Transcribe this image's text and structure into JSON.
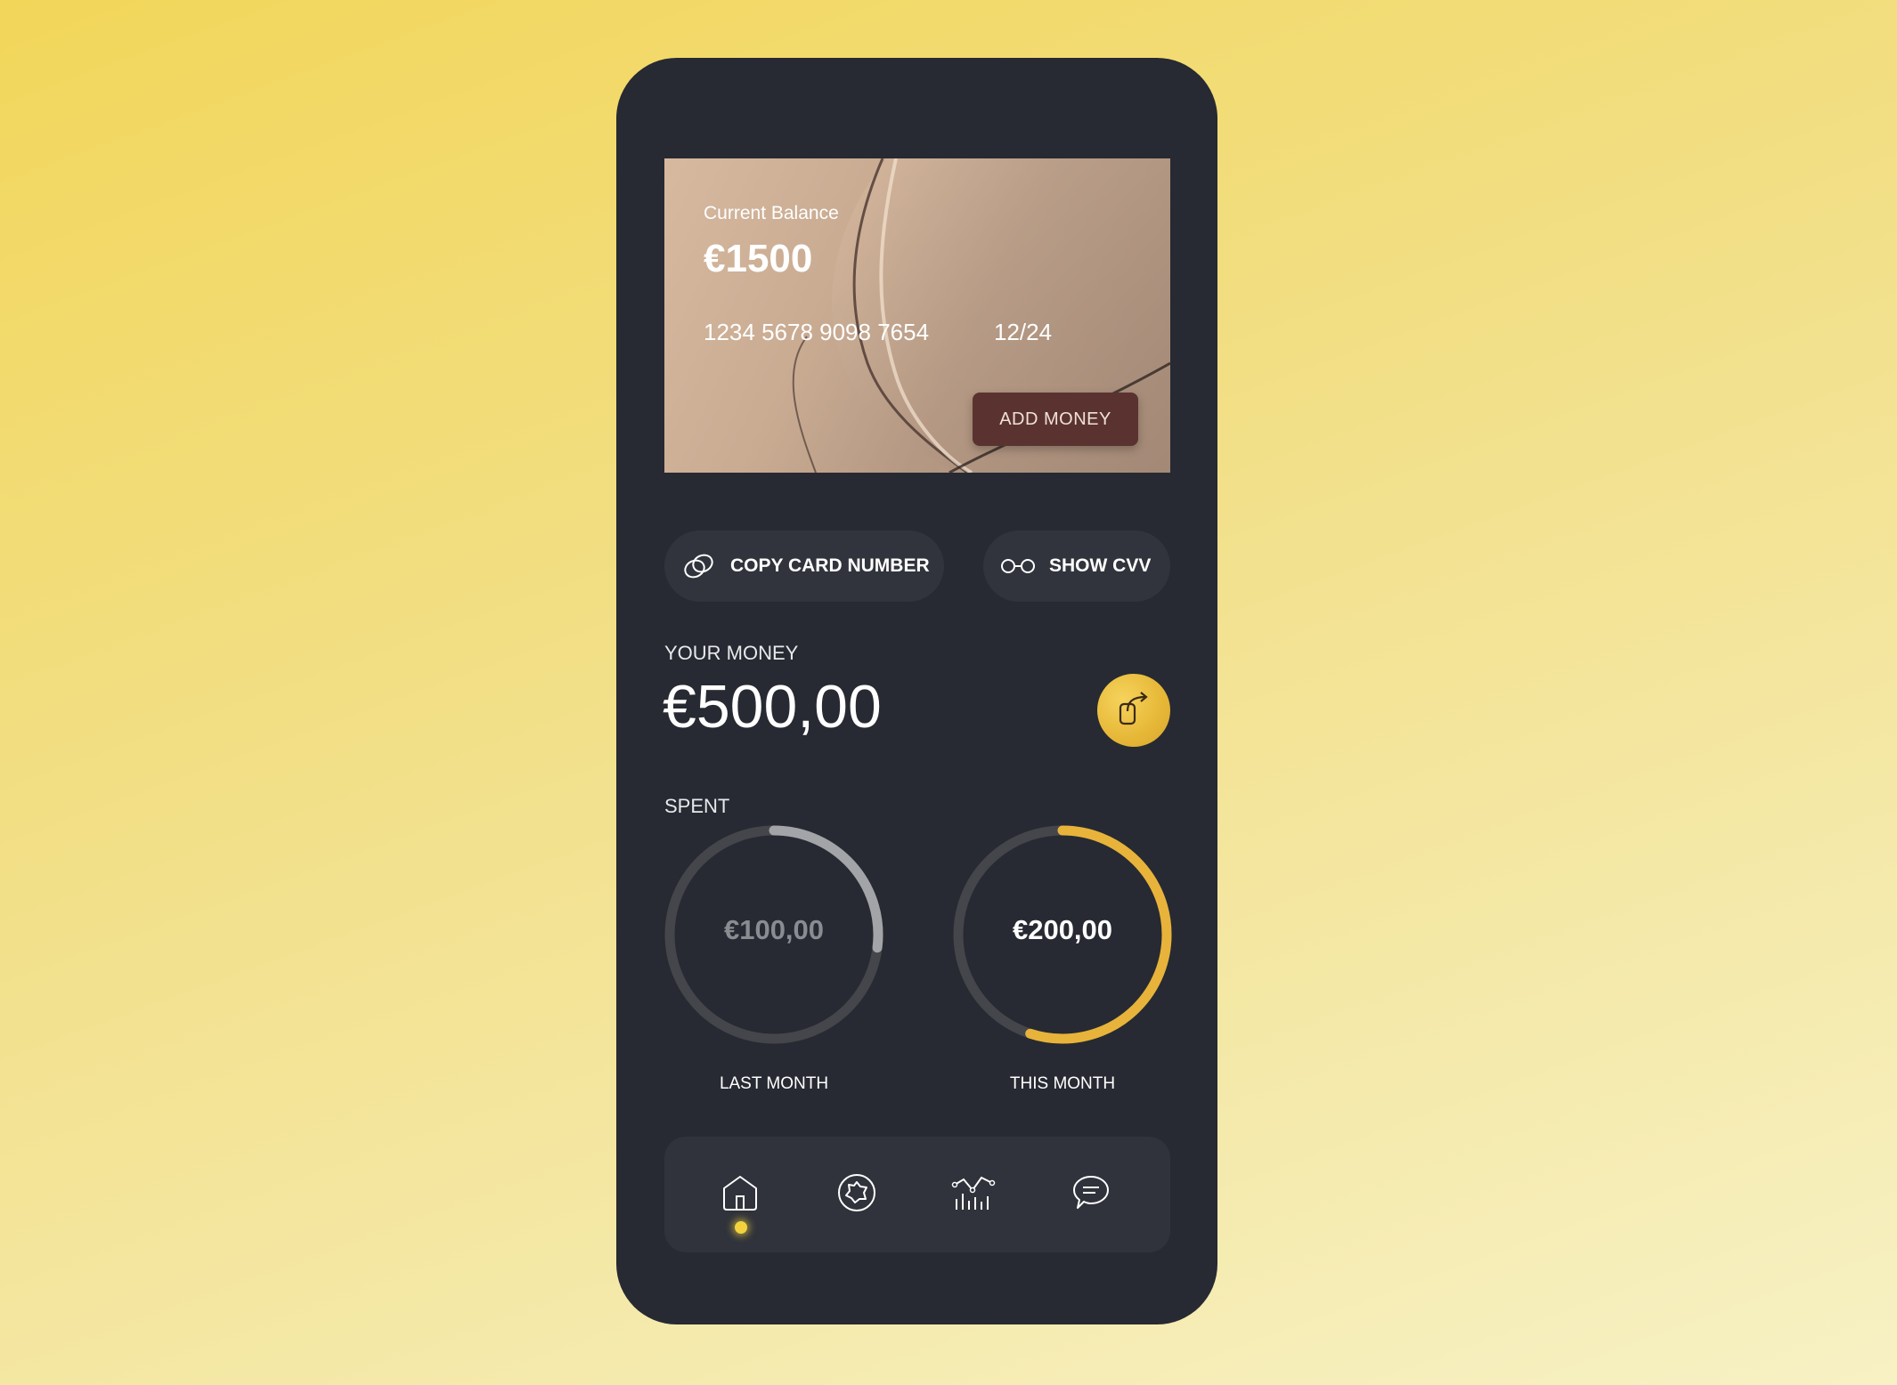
{
  "card": {
    "balance_label": "Current Balance",
    "balance_value": "€1500",
    "number": "1234 5678 9098 7654",
    "expiry": "12/24",
    "add_money_label": "ADD MONEY"
  },
  "actions": {
    "copy_label": "COPY CARD NUMBER",
    "copy_icon": "link-rings-icon",
    "cvv_label": "SHOW CVV",
    "cvv_icon": "glasses-icon"
  },
  "money": {
    "label": "YOUR MONEY",
    "value": "€500,00",
    "share_icon": "share-icon"
  },
  "spent": {
    "label": "SPENT",
    "last_month": {
      "value": "€100,00",
      "caption": "LAST MONTH",
      "progress": 0.27
    },
    "this_month": {
      "value": "€200,00",
      "caption": "THIS MONTH",
      "progress": 0.55
    }
  },
  "nav": {
    "items": [
      "home-icon",
      "explore-icon",
      "stats-icon",
      "chat-icon"
    ],
    "active": "home"
  },
  "colors": {
    "accent": "#e8b33a",
    "panel": "#272a32",
    "card_button": "#5a3330"
  }
}
